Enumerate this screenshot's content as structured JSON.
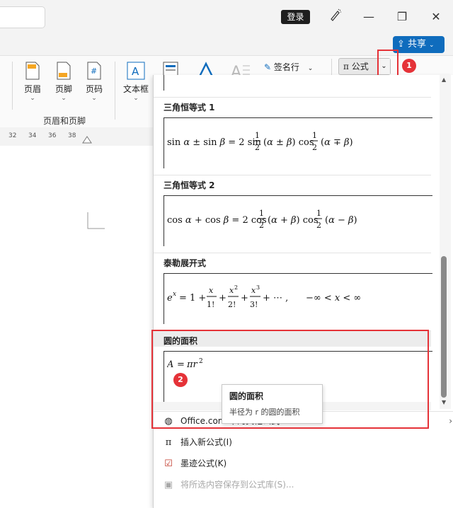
{
  "titlebar": {
    "login_label": "登录"
  },
  "share": {
    "label": "共享"
  },
  "ribbon": {
    "header_label": "页眉",
    "footer_label": "页脚",
    "page_number_label": "页码",
    "textbox_label": "文本框",
    "signature_label": "签名行",
    "formula_label": "公式",
    "group_label": "页眉和页脚"
  },
  "ruler": {
    "ticks": [
      "32",
      "34",
      "36",
      "38"
    ]
  },
  "gallery": {
    "sections": [
      {
        "title": "三角恒等式 1"
      },
      {
        "title": "三角恒等式 2"
      },
      {
        "title": "泰勒展开式"
      },
      {
        "title": "圆的面积"
      }
    ],
    "menu": {
      "office_label": "Office.com 中的其他公式",
      "insert_label": "插入新公式(I)",
      "ink_label": "墨迹公式(K)",
      "save_label": "将所选内容保存到公式库(S)..."
    }
  },
  "tooltip": {
    "title": "圆的面积",
    "description": "半径为 r 的圆的面积"
  },
  "callouts": {
    "badge1": "1",
    "badge2": "2"
  },
  "colors": {
    "accent": "#0f6cbd",
    "callout_red": "#e53238"
  }
}
